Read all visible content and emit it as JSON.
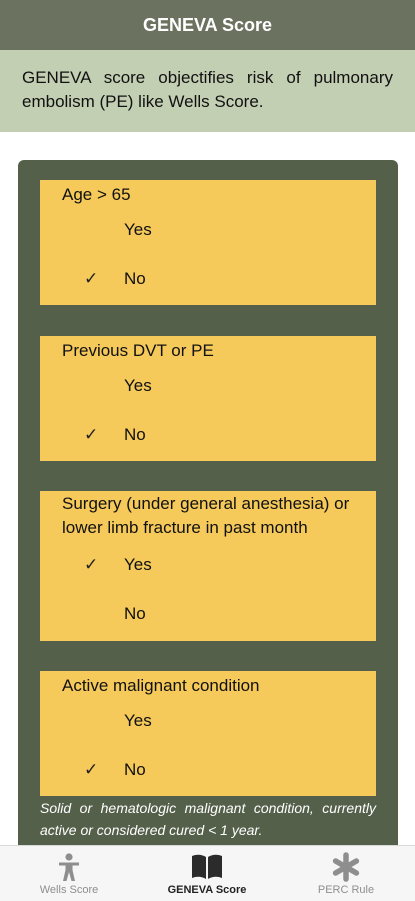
{
  "header": {
    "title": "GENEVA Score"
  },
  "intro": {
    "text": "GENEVA score objectifies risk of pulmonary embolism (PE) like Wells Score."
  },
  "questions": [
    {
      "title": "Age > 65",
      "options": [
        {
          "label": "Yes",
          "checked": false
        },
        {
          "label": "No",
          "checked": true
        }
      ]
    },
    {
      "title": "Previous DVT or PE",
      "options": [
        {
          "label": "Yes",
          "checked": false
        },
        {
          "label": "No",
          "checked": true
        }
      ]
    },
    {
      "title": "Surgery (under general anesthesia) or lower limb fracture in past month",
      "options": [
        {
          "label": "Yes",
          "checked": true
        },
        {
          "label": "No",
          "checked": false
        }
      ]
    },
    {
      "title": "Active malignant condition",
      "options": [
        {
          "label": "Yes",
          "checked": false
        },
        {
          "label": "No",
          "checked": true
        }
      ]
    }
  ],
  "note": "Solid or hematologic malignant condition, currently active or considered cured < 1 year.",
  "check_mark": "✓",
  "tabs": [
    {
      "label": "Wells Score",
      "icon": "person-icon",
      "active": false
    },
    {
      "label": "GENEVA Score",
      "icon": "book-icon",
      "active": true
    },
    {
      "label": "PERC Rule",
      "icon": "asterisk-icon",
      "active": false
    }
  ],
  "colors": {
    "header_bg": "#6b7360",
    "intro_bg": "#c3cfb3",
    "panel_bg": "#55604b",
    "card_bg": "#f5c95a",
    "tab_active": "#222222",
    "tab_inactive": "#8e8e8e"
  }
}
